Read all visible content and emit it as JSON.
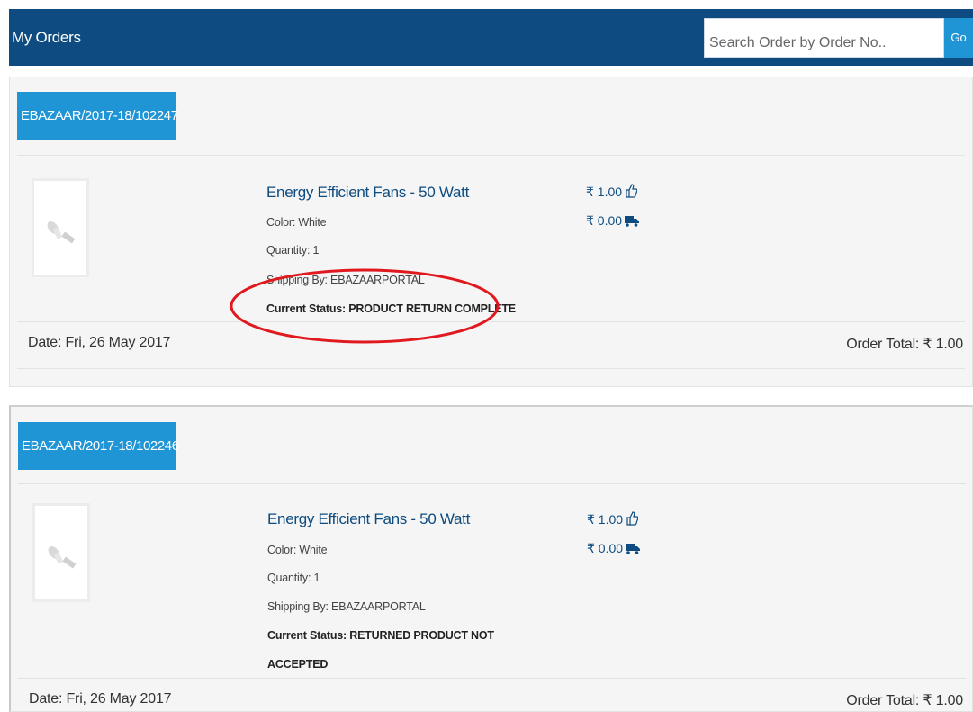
{
  "header": {
    "title": "My Orders",
    "search_placeholder": "Search Order by Order No..",
    "go_label": "Go"
  },
  "orders": [
    {
      "order_id": "EBAZAAR/2017-18/102247",
      "product_name": "Energy Efficient Fans - 50 Watt",
      "color": "Color: White",
      "quantity": "Quantity: 1",
      "shipping": "Shipping By: EBAZAARPORTAL",
      "status_label": "Current Status: ",
      "status_value": "PRODUCT RETURN COMPLETE",
      "price": "₹ 1.00",
      "shipping_price": "₹ 0.00",
      "date": "Date: Fri, 26 May 2017",
      "total": "Order Total: ₹ 1.00"
    },
    {
      "order_id": "EBAZAAR/2017-18/102246",
      "product_name": "Energy Efficient Fans - 50 Watt",
      "color": "Color: White",
      "quantity": "Quantity: 1",
      "shipping": "Shipping By: EBAZAARPORTAL",
      "status_label": "Current Status: ",
      "status_value": "RETURNED PRODUCT NOT",
      "status_value_2": "ACCEPTED",
      "price": "₹ 1.00",
      "shipping_price": "₹ 0.00",
      "date": "Date: Fri, 26 May 2017",
      "total": "Order Total: ₹ 1.00"
    }
  ],
  "colors": {
    "header_bg": "#0d4b80",
    "accent": "#1f95d6",
    "annotation": "#e0191f"
  },
  "icons": [
    "thumbs-up-icon",
    "truck-icon",
    "fan-product-image"
  ]
}
